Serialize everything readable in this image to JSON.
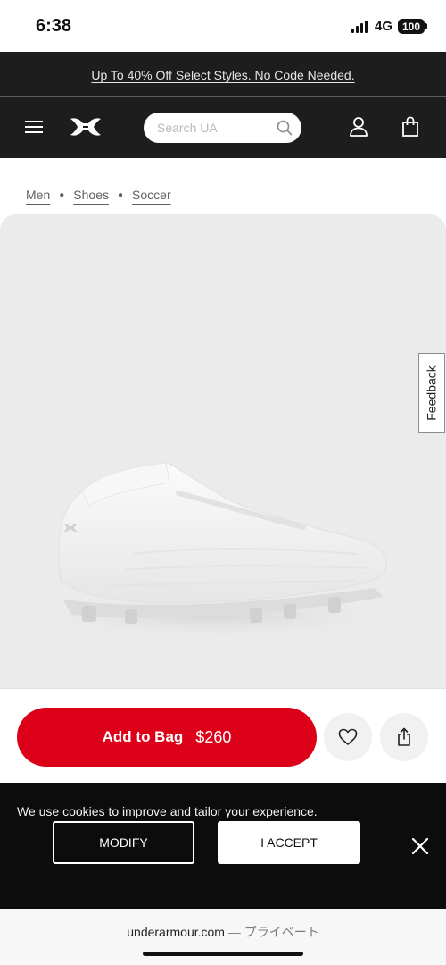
{
  "status_bar": {
    "time": "6:38",
    "network": "4G",
    "battery": "100"
  },
  "promo": {
    "text": "Up To 40% Off Select Styles. No Code Needed."
  },
  "header": {
    "search_placeholder": "Search UA"
  },
  "breadcrumb": {
    "items": [
      "Men",
      "Shoes",
      "Soccer"
    ]
  },
  "product": {
    "feedback_label": "Feedback",
    "shoe_color": "#f4f4f4"
  },
  "actions": {
    "add_to_bag_label": "Add to Bag",
    "price": "$260"
  },
  "cookie": {
    "text": "We use cookies to improve and tailor your experience.",
    "modify_label": "MODIFY",
    "accept_label": "I ACCEPT"
  },
  "browser": {
    "domain": "underarmour.com",
    "suffix": " — プライベート"
  },
  "colors": {
    "brand_red": "#dc0019",
    "header_bg": "#1d1d1d",
    "cookie_bg": "#0c0c0c"
  }
}
